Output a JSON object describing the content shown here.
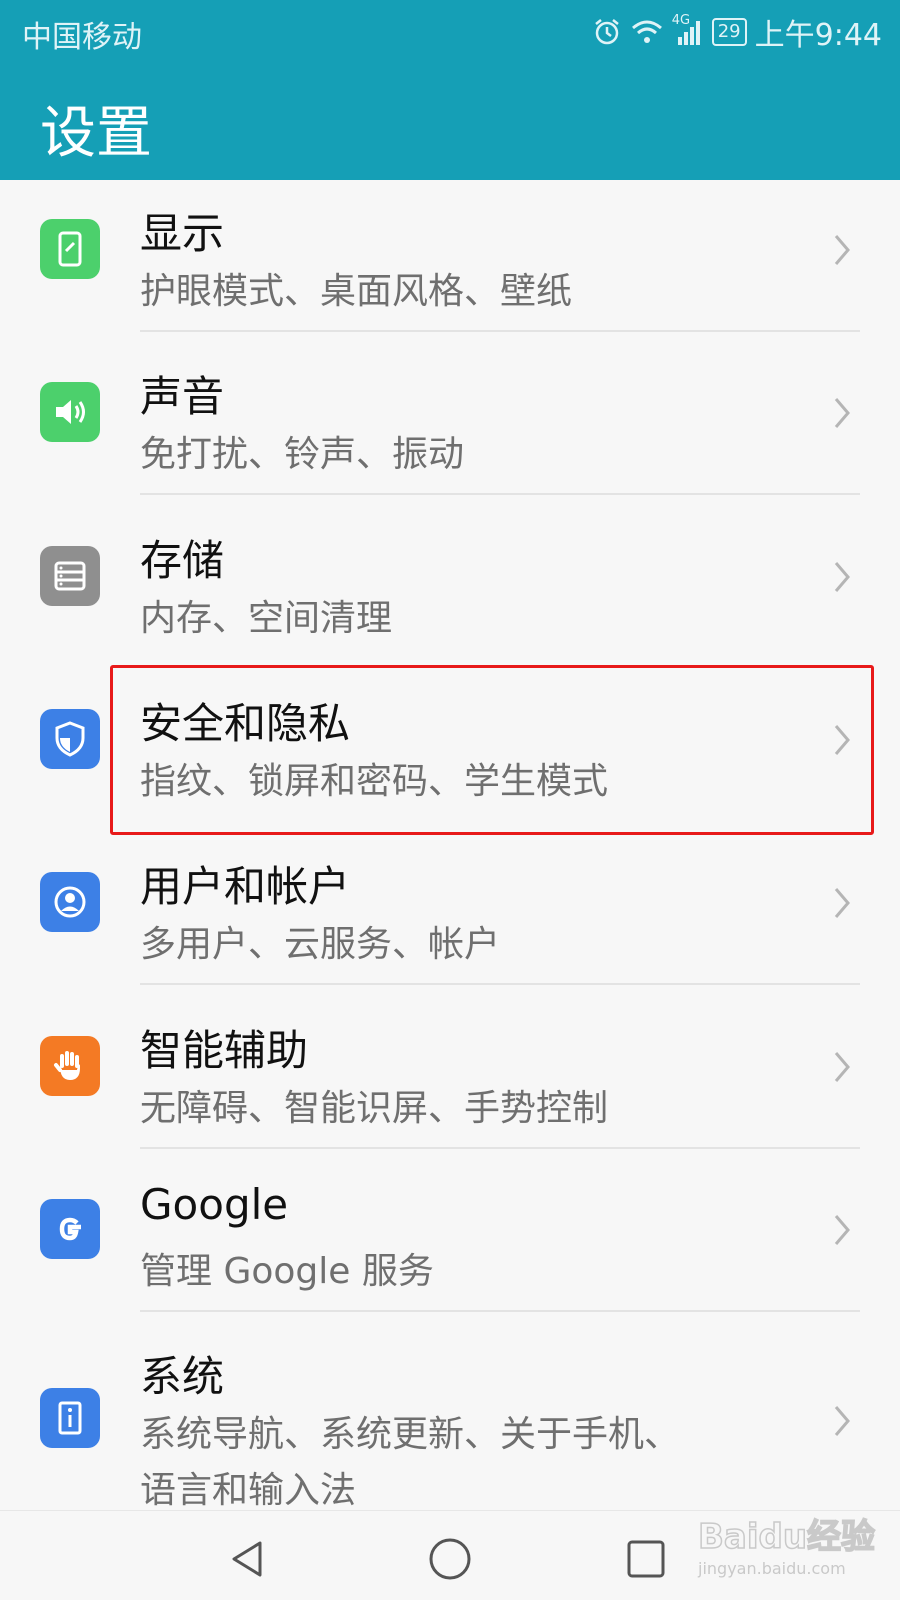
{
  "status_bar": {
    "carrier": "中国移动",
    "network": "4G",
    "battery": "29",
    "time": "上午9:44",
    "icons": [
      "alarm-icon",
      "wifi-icon",
      "signal-icon",
      "battery-icon"
    ]
  },
  "header": {
    "title": "设置"
  },
  "settings_items": [
    {
      "title": "显示",
      "subtitle": "护眼模式、桌面风格、壁纸",
      "icon": "display-icon",
      "color": "#4cd06c"
    },
    {
      "title": "声音",
      "subtitle": "免打扰、铃声、振动",
      "icon": "sound-icon",
      "color": "#4cd06c"
    },
    {
      "title": "存储",
      "subtitle": "内存、空间清理",
      "icon": "storage-icon",
      "color": "#8f8f8f"
    },
    {
      "title": "安全和隐私",
      "subtitle": "指纹、锁屏和密码、学生模式",
      "icon": "shield-icon",
      "color": "#3d80e6"
    },
    {
      "title": "用户和帐户",
      "subtitle": "多用户、云服务、帐户",
      "icon": "user-icon",
      "color": "#3d80e6"
    },
    {
      "title": "智能辅助",
      "subtitle": "无障碍、智能识屏、手势控制",
      "icon": "hand-icon",
      "color": "#f47a24"
    },
    {
      "title": "Google",
      "subtitle": "管理 Google 服务",
      "icon": "google-icon",
      "color": "#3d80e6"
    },
    {
      "title": "系统",
      "subtitle": "系统导航、系统更新、关于手机、",
      "subtitle2": "语言和输入法",
      "icon": "system-icon",
      "color": "#3d80e6"
    }
  ],
  "highlight": {
    "target": "安全和隐私",
    "color": "#e81a1a"
  },
  "nav_bar": {
    "icons": [
      "back-icon",
      "home-icon",
      "recents-icon"
    ]
  },
  "watermark": {
    "text": "Baidu经验",
    "url": "jingyan.baidu.com"
  },
  "colors": {
    "accent": "#159fb6"
  }
}
